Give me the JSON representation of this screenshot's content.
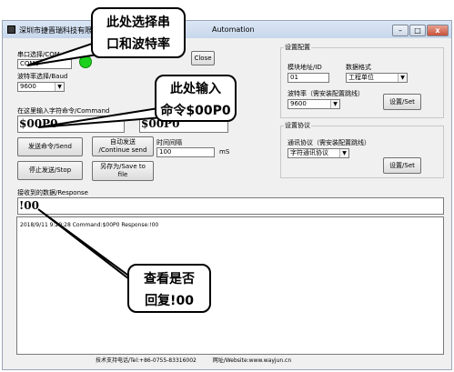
{
  "window": {
    "title_left": "深圳市捷晋瑞科技有限公",
    "title_right": "Automation",
    "controls": {
      "minimize": "–",
      "maximize": "□",
      "close": "x"
    }
  },
  "serial": {
    "port_label": "串口选择/COM",
    "port_value": "COM6",
    "close_button": "Close",
    "baud_label": "波特率选择/Baud",
    "baud_value": "9600"
  },
  "command": {
    "input_label": "在这里输入字符命令/Command",
    "command_value": "$00P0",
    "command_value_2": "$00P0"
  },
  "actions": {
    "send": "发送命令/Send",
    "auto_send_line1": "自动发送",
    "auto_send_line2": "/Continue send",
    "interval_label": "时间间隔",
    "interval_value": "100",
    "interval_unit": "mS",
    "stop": "停止发送/Stop",
    "save_line1": "另存为/Save to",
    "save_line2": "file"
  },
  "config": {
    "group_title": "设置配置",
    "module_label": "模块地址/ID",
    "module_value": "01",
    "format_label": "数据格式",
    "format_value": "工程单位",
    "baud_label": "波特率（需安装配置跳线）",
    "baud_value": "9600",
    "set_button": "设置/Set"
  },
  "protocol": {
    "group_title": "设置协议",
    "protocol_label": "通讯协议（需安装配置跳线）",
    "protocol_value": "字符通讯协议",
    "set_button": "设置/Set"
  },
  "response": {
    "label": "接收到的数据/Response",
    "value": "!00"
  },
  "log": {
    "line": "2018/9/11 9:29:28   Command:$00P0   Response:!00"
  },
  "footer": {
    "support": "技术支持电话/Tel:+86-0755-83316002",
    "website": "网址/Website:www.wayjun.cn"
  },
  "callouts": {
    "port_baud": [
      "此处选择串",
      "口和波特率"
    ],
    "command": [
      "此处输入",
      "命令$00P0"
    ],
    "response": [
      "查看是否",
      "回复!00"
    ]
  }
}
